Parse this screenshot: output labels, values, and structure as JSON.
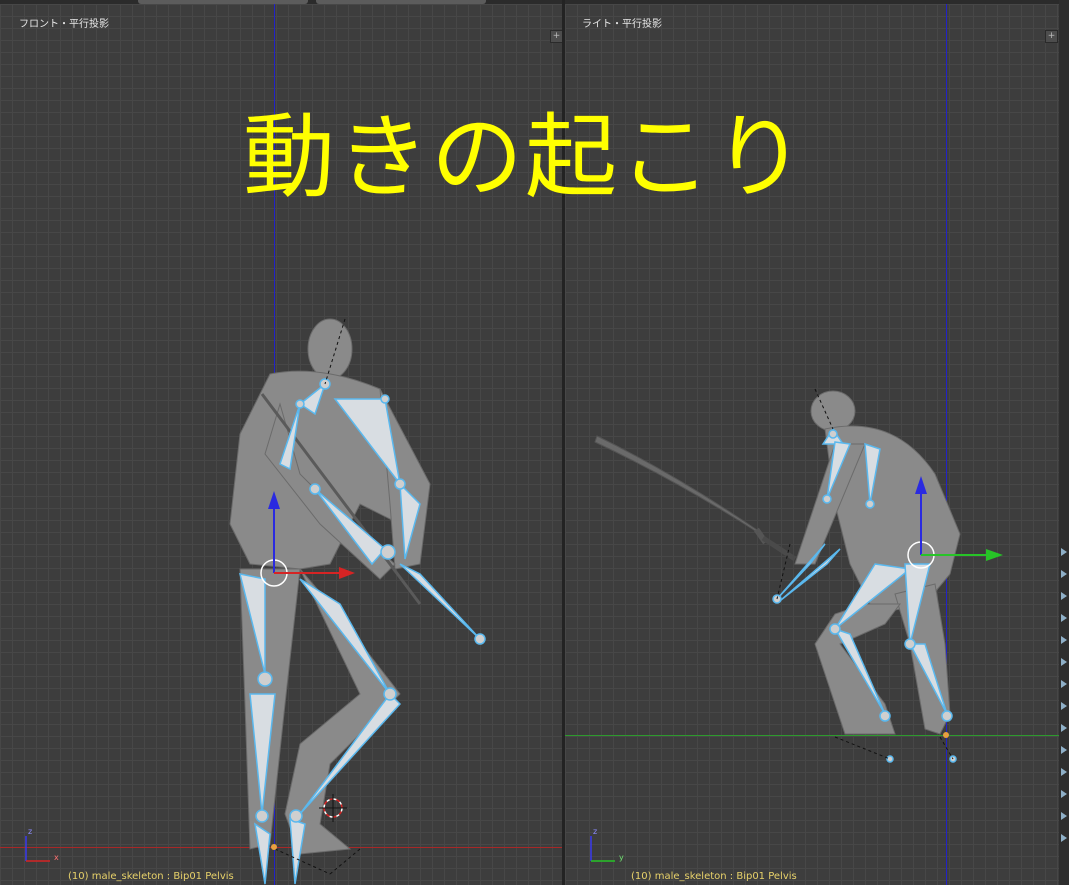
{
  "overlay_title": "動きの起こり",
  "viewports": {
    "front": {
      "title": "フロント・平行投影",
      "status": "(10) male_skeleton : Bip01 Pelvis",
      "gizmo": {
        "z": "z",
        "x": "x"
      }
    },
    "right": {
      "title": "ライト・平行投影",
      "status": "(10) male_skeleton : Bip01 Pelvis",
      "gizmo": {
        "z": "z",
        "y": "y"
      }
    }
  },
  "colors": {
    "overlay_text": "#ffff00",
    "bone": "#5ab8ee",
    "body": "#8c8c8c",
    "status_text": "#e8d26a",
    "axis_x": "#d62424",
    "axis_y": "#27c427",
    "axis_z": "#2a2ae0"
  }
}
